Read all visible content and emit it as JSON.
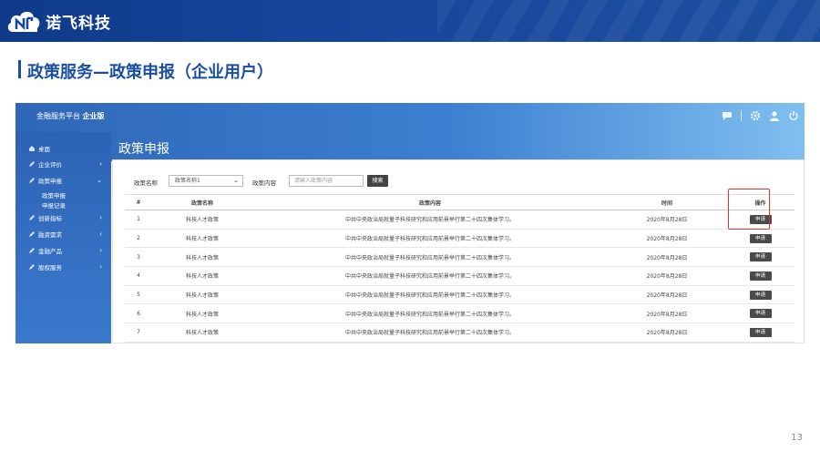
{
  "brand": {
    "name": "诺飞科技"
  },
  "slide": {
    "heading": "政策服务—政策申报（企业用户）",
    "page_number": "13"
  },
  "app": {
    "title_prefix": "金融服务平台",
    "title_suffix": "企业版",
    "page_title": "政策申报",
    "top_icons": [
      "chat-icon",
      "settings-icon",
      "user-icon",
      "power-icon"
    ],
    "sidebar": {
      "items": [
        {
          "label": "桌面",
          "icon": "home-icon",
          "expandable": false
        },
        {
          "label": "企业评价",
          "icon": "edit-icon",
          "expandable": true,
          "chevron": "‹"
        },
        {
          "label": "政策申报",
          "icon": "edit-icon",
          "expandable": true,
          "chevron": "⌄"
        },
        {
          "label": "创新指标",
          "icon": "edit-icon",
          "expandable": true,
          "chevron": "‹"
        },
        {
          "label": "融资需求",
          "icon": "edit-icon",
          "expandable": true,
          "chevron": "‹"
        },
        {
          "label": "金融产品",
          "icon": "edit-icon",
          "expandable": true,
          "chevron": "‹"
        },
        {
          "label": "股权服务",
          "icon": "edit-icon",
          "expandable": true,
          "chevron": "‹"
        }
      ],
      "subitems": [
        "政策申报",
        "申报记录"
      ]
    },
    "filter": {
      "policy_name_label": "政策名称",
      "policy_name_value": "政策名称1",
      "policy_content_label": "政策内容",
      "policy_content_placeholder": "请输入政策内容",
      "search_label": "搜索"
    },
    "table": {
      "headers": [
        "#",
        "政策名称",
        "政策内容",
        "时间",
        "操作"
      ],
      "rows": [
        {
          "no": "1",
          "name": "科技人才政策",
          "content": "中共中央政治局就量子科技研究和应用前景举行第二十四次集体学习。",
          "time": "2020年8月28日",
          "action": "申请"
        },
        {
          "no": "2",
          "name": "科技人才政策",
          "content": "中共中央政治局就量子科技研究和应用前景举行第二十四次集体学习。",
          "time": "2020年8月28日",
          "action": "申请"
        },
        {
          "no": "3",
          "name": "科技人才政策",
          "content": "中共中央政治局就量子科技研究和应用前景举行第二十四次集体学习。",
          "time": "2020年8月28日",
          "action": "申请"
        },
        {
          "no": "4",
          "name": "科技人才政策",
          "content": "中共中央政治局就量子科技研究和应用前景举行第二十四次集体学习。",
          "time": "2020年8月28日",
          "action": "申请"
        },
        {
          "no": "5",
          "name": "科技人才政策",
          "content": "中共中央政治局就量子科技研究和应用前景举行第二十四次集体学习。",
          "time": "2020年8月28日",
          "action": "申请"
        },
        {
          "no": "6",
          "name": "科技人才政策",
          "content": "中共中央政治局就量子科技研究和应用前景举行第二十四次集体学习。",
          "time": "2020年8月28日",
          "action": "申请"
        },
        {
          "no": "7",
          "name": "科技人才政策",
          "content": "中共中央政治局就量子科技研究和应用前景举行第二十四次集体学习。",
          "time": "2020年8月28日",
          "action": "申请"
        }
      ]
    }
  },
  "colors": {
    "banner": "#17479c",
    "accent": "#1a4fa0",
    "highlight": "#e53030",
    "button": "#444444"
  }
}
